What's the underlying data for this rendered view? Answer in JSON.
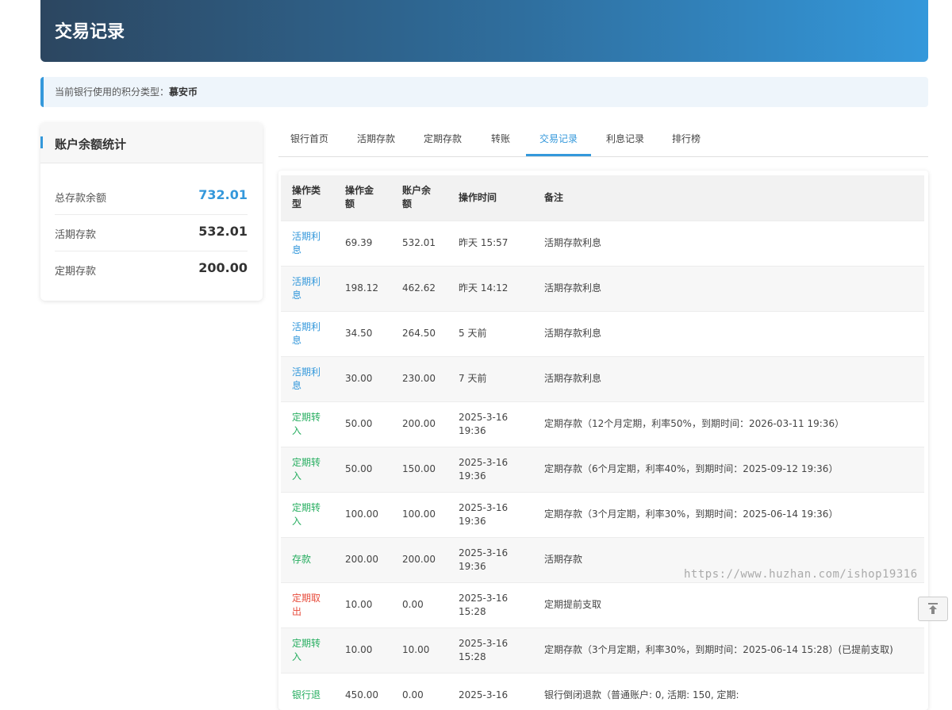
{
  "header": {
    "title": "交易记录"
  },
  "notice": {
    "prefix": "当前银行使用的积分类型：",
    "currency": "慕安币"
  },
  "stats": {
    "title": "账户余额统计",
    "rows": [
      {
        "label": "总存款余额",
        "value": "732.01"
      },
      {
        "label": "活期存款",
        "value": "532.01"
      },
      {
        "label": "定期存款",
        "value": "200.00"
      }
    ]
  },
  "tabs": [
    "银行首页",
    "活期存款",
    "定期存款",
    "转账",
    "交易记录",
    "利息记录",
    "排行榜"
  ],
  "active_tab": "交易记录",
  "table": {
    "headers": [
      "操作类型",
      "操作金额",
      "账户余额",
      "操作时间",
      "备注"
    ],
    "rows": [
      {
        "type": "活期利息",
        "amount": "69.39",
        "balance": "532.01",
        "time": "昨天 15:57",
        "note": "活期存款利息"
      },
      {
        "type": "活期利息",
        "amount": "198.12",
        "balance": "462.62",
        "time": "昨天 14:12",
        "note": "活期存款利息"
      },
      {
        "type": "活期利息",
        "amount": "34.50",
        "balance": "264.50",
        "time": "5 天前",
        "note": "活期存款利息"
      },
      {
        "type": "活期利息",
        "amount": "30.00",
        "balance": "230.00",
        "time": "7 天前",
        "note": "活期存款利息"
      },
      {
        "type": "定期转入",
        "amount": "50.00",
        "balance": "200.00",
        "time": "2025-3-16 19:36",
        "note": "定期存款（12个月定期，利率50%，到期时间：2026-03-11 19:36）"
      },
      {
        "type": "定期转入",
        "amount": "50.00",
        "balance": "150.00",
        "time": "2025-3-16 19:36",
        "note": "定期存款（6个月定期，利率40%，到期时间：2025-09-12 19:36）"
      },
      {
        "type": "定期转入",
        "amount": "100.00",
        "balance": "100.00",
        "time": "2025-3-16 19:36",
        "note": "定期存款（3个月定期，利率30%，到期时间：2025-06-14 19:36）"
      },
      {
        "type": "存款",
        "amount": "200.00",
        "balance": "200.00",
        "time": "2025-3-16 19:36",
        "note": "活期存款"
      },
      {
        "type": "定期取出",
        "amount": "10.00",
        "balance": "0.00",
        "time": "2025-3-16 15:28",
        "note": "定期提前支取"
      },
      {
        "type": "定期转入",
        "amount": "10.00",
        "balance": "10.00",
        "time": "2025-3-16 15:28",
        "note": "定期存款（3个月定期，利率30%，到期时间：2025-06-14 15:28）(已提前支取)"
      },
      {
        "type": "银行退",
        "amount": "450.00",
        "balance": "0.00",
        "time": "2025-3-16",
        "note": "银行倒闭退款（普通账户: 0, 活期: 150, 定期:"
      }
    ]
  },
  "watermark": "https://www.huzhan.com/ishop19316",
  "colors": {
    "interest": "#3498db",
    "deposit": "#27ae60",
    "withdraw": "#e74c3c",
    "accent": "#3498db"
  },
  "icons": {
    "back_to_top": "arrow-up-icon"
  }
}
